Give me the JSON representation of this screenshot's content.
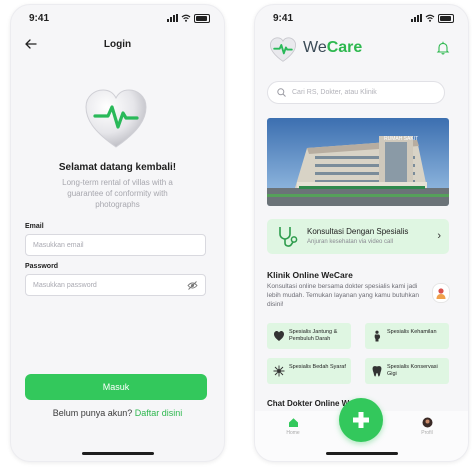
{
  "colors": {
    "accent": "#33c85c",
    "accent_dark": "#2eb84f",
    "soft_green": "#dff6e2"
  },
  "status_time": "9:41",
  "login": {
    "title": "Login",
    "welcome": "Selamat datang kembali!",
    "subtitle": "Long-term rental of villas with a guarantee of conformity with photographs",
    "email_label": "Email",
    "email_placeholder": "Masukkan email",
    "password_label": "Password",
    "password_placeholder": "Masukkan password",
    "submit": "Masuk",
    "register_prompt": "Belum punya akun?",
    "register_link": "Daftar disini"
  },
  "home": {
    "brand_we": "We",
    "brand_care": "Care",
    "search_placeholder": "Cari RS, Dokter, atau Klinik",
    "hospital_sign": "RUMAH SAKIT",
    "consult_title": "Konsultasi Dengan Spesialis",
    "consult_sub": "Anjuran kesehatan via video call",
    "clinic_title": "Klinik Online WeCare",
    "clinic_desc": "Konsultasi online bersama dokter spesialis kami jadi lebih mudah. Temukan layanan yang kamu butuhkan disini!",
    "specialties": [
      {
        "label": "Spesialis Jantung & Pembuluh Darah",
        "icon": "heart-icon"
      },
      {
        "label": "Spesialis Kehamilan",
        "icon": "pregnancy-icon"
      },
      {
        "label": "Spesialis Bedah Syaraf",
        "icon": "nerve-icon"
      },
      {
        "label": "Spesialis Konservasi Gigi",
        "icon": "tooth-icon"
      }
    ],
    "chat_title": "Chat Dokter Online We",
    "nav": {
      "home": "Home",
      "profile": "Profil"
    }
  }
}
